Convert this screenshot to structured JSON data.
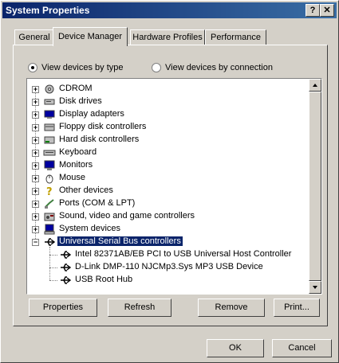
{
  "window": {
    "title": "System Properties",
    "help_label": "?",
    "close_label": "✕"
  },
  "tabs": [
    {
      "label": "General",
      "active": false
    },
    {
      "label": "Device Manager",
      "active": true
    },
    {
      "label": "Hardware Profiles",
      "active": false
    },
    {
      "label": "Performance",
      "active": false
    }
  ],
  "view_options": {
    "by_type": {
      "label": "View devices by type",
      "selected": true
    },
    "by_connection": {
      "label": "View devices by connection",
      "selected": false
    }
  },
  "tree": {
    "nodes": [
      {
        "label": "CDROM",
        "expander": "+",
        "icon": "cdrom-icon"
      },
      {
        "label": "Disk drives",
        "expander": "+",
        "icon": "disk-drive-icon"
      },
      {
        "label": "Display adapters",
        "expander": "+",
        "icon": "display-adapter-icon"
      },
      {
        "label": "Floppy disk controllers",
        "expander": "+",
        "icon": "floppy-controller-icon"
      },
      {
        "label": "Hard disk controllers",
        "expander": "+",
        "icon": "hard-disk-controller-icon"
      },
      {
        "label": "Keyboard",
        "expander": "+",
        "icon": "keyboard-icon"
      },
      {
        "label": "Monitors",
        "expander": "+",
        "icon": "monitor-icon"
      },
      {
        "label": "Mouse",
        "expander": "+",
        "icon": "mouse-icon"
      },
      {
        "label": "Other devices",
        "expander": "+",
        "icon": "question-mark-icon"
      },
      {
        "label": "Ports (COM & LPT)",
        "expander": "+",
        "icon": "port-icon"
      },
      {
        "label": "Sound, video and game controllers",
        "expander": "+",
        "icon": "sound-icon"
      },
      {
        "label": "System devices",
        "expander": "+",
        "icon": "system-device-icon"
      },
      {
        "label": "Universal Serial Bus controllers",
        "expander": "−",
        "icon": "usb-icon",
        "selected": true
      }
    ],
    "usb_children": [
      {
        "label": "Intel 82371AB/EB PCI to USB Universal Host Controller",
        "icon": "usb-icon"
      },
      {
        "label": "D-Link DMP-110  NJCMp3.Sys  MP3 USB Device",
        "icon": "usb-icon"
      },
      {
        "label": "USB Root Hub",
        "icon": "usb-icon"
      }
    ]
  },
  "buttons": {
    "properties": "Properties",
    "refresh": "Refresh",
    "remove": "Remove",
    "print": "Print...",
    "ok": "OK",
    "cancel": "Cancel"
  },
  "colors": {
    "title_bar": "#0a246a",
    "selection": "#0a246a",
    "face": "#d4d0c8"
  }
}
